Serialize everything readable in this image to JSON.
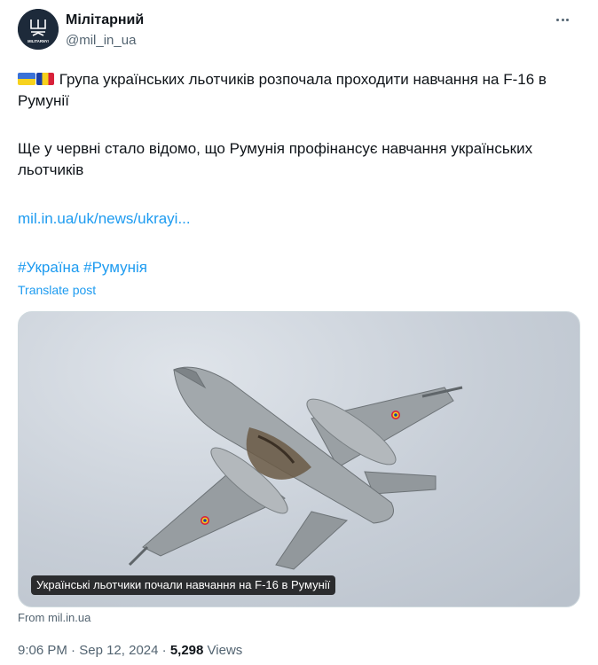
{
  "author": {
    "name": "Мілітарний",
    "handle": "@mil_in_ua",
    "avatar_text": "MILITARNYI"
  },
  "post": {
    "line1": "Група українських льотчиків розпочала проходити навчання на F-16 в Румунії",
    "line2": "Ще у червні стало відомо, що Румунія профінансує навчання українських льотчиків",
    "link_text": "mil.in.ua/uk/news/ukrayi...",
    "hashtag1": "#Україна",
    "hashtag2": "#Румунія",
    "translate_label": "Translate post"
  },
  "media": {
    "caption": "Українські льотчики почали навчання на F-16 в Румунії",
    "source": "From mil.in.ua"
  },
  "meta": {
    "time": "9:06 PM",
    "separator": "·",
    "date": "Sep 12, 2024",
    "views_count": "5,298",
    "views_label": "Views"
  },
  "colors": {
    "accent": "#1d9bf0",
    "muted": "#536471",
    "text": "#0f1419"
  },
  "icons": [
    "more-options-icon",
    "ukraine-flag-icon",
    "romania-flag-icon"
  ]
}
